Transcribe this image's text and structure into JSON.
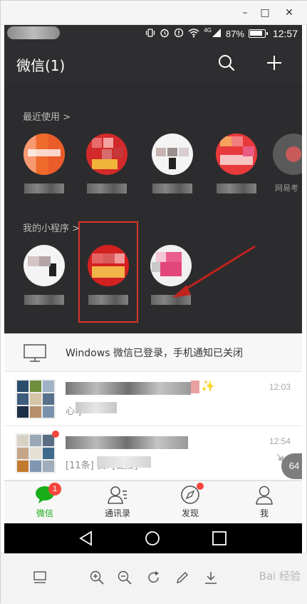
{
  "window": {
    "minimize_glyph": "–",
    "maximize_glyph": "□",
    "close_glyph": "✕"
  },
  "status_bar": {
    "network": "4G",
    "battery_percent": "87%",
    "time": "12:57"
  },
  "header": {
    "title": "微信(1)",
    "icons": [
      "search-icon",
      "plus-icon"
    ]
  },
  "mini_programs": {
    "recent_label": "最近使用 >",
    "recent_apps": [
      {
        "name": "",
        "color": "#f0672b"
      },
      {
        "name": "",
        "color": "#d22a2a"
      },
      {
        "name": "",
        "color": "#f4f4f4"
      },
      {
        "name": "",
        "color": "#e8393c"
      },
      {
        "name": "网易考",
        "color": "#555555"
      }
    ],
    "mine_label": "我的小程序 >",
    "mine_apps": [
      {
        "name": "",
        "color": "#f4f4f4"
      },
      {
        "name": "",
        "color": "#d32020"
      },
      {
        "name": "",
        "color": "#f0f0f0"
      }
    ]
  },
  "login_notice": "Windows 微信已登录，手机通知已关闭",
  "chats": [
    {
      "time": "12:03",
      "preview": "心            ]"
    },
    {
      "time": "12:54",
      "preview": "[11条]              我: [链接]"
    }
  ],
  "float_count": "64",
  "tabs": [
    {
      "label": "微信",
      "icon": "chat-bubble-icon",
      "badge": "1",
      "active": true
    },
    {
      "label": "通讯录",
      "icon": "contacts-icon",
      "active": false
    },
    {
      "label": "发现",
      "icon": "compass-icon",
      "active": false
    },
    {
      "label": "我",
      "icon": "person-icon",
      "active": false
    }
  ],
  "viewer_tools": [
    "layout-icon",
    "zoom-in-icon",
    "zoom-out-icon",
    "rotate-icon",
    "edit-icon",
    "download-icon"
  ],
  "watermark": "Bai 经验",
  "colors": {
    "accent_green": "#1aad19",
    "badge_red": "#f5453d",
    "highlight_red": "#d9352b"
  }
}
